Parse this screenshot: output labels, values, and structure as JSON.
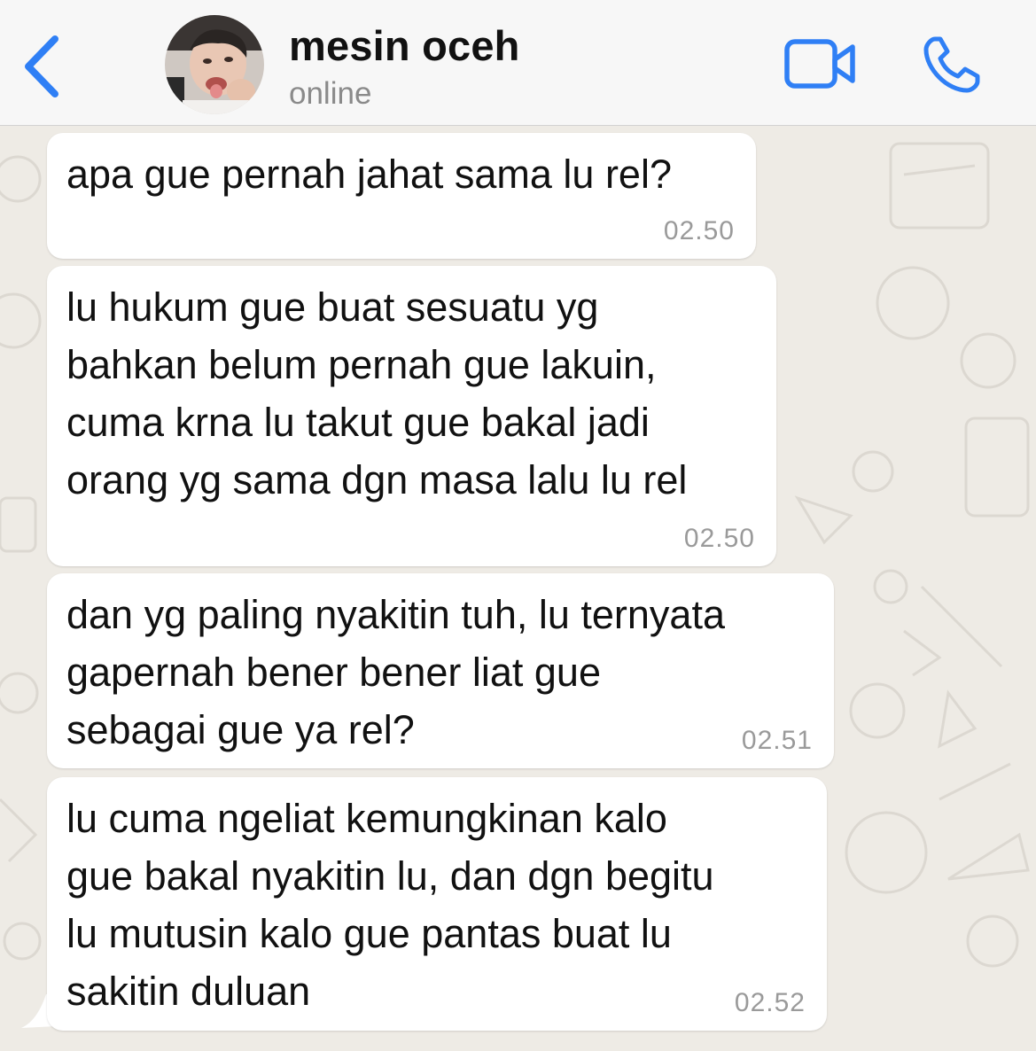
{
  "header": {
    "contact_name": "mesin oceh",
    "status": "online",
    "back_icon": "chevron-left-icon",
    "video_icon": "video-camera-icon",
    "call_icon": "phone-icon",
    "accent_color": "#2f7ff5"
  },
  "messages": [
    {
      "text": "apa gue pernah jahat sama lu rel?",
      "time": "02.50"
    },
    {
      "text": "lu hukum gue buat sesuatu yg\nbahkan belum pernah gue lakuin,\ncuma krna lu takut gue bakal jadi\norang yg sama dgn masa lalu lu rel",
      "time": "02.50"
    },
    {
      "text": "dan yg paling nyakitin tuh, lu ternyata\ngapernah bener bener liat gue\nsebagai gue ya rel?",
      "time": "02.51"
    },
    {
      "text": "lu cuma ngeliat kemungkinan kalo\ngue bakal nyakitin lu, dan dgn begitu\nlu mutusin kalo gue pantas buat lu\nsakitin duluan",
      "time": "02.52"
    }
  ],
  "colors": {
    "wallpaper": "#eeebe5",
    "bubble": "#ffffff",
    "timestamp": "#9a9a9a"
  }
}
